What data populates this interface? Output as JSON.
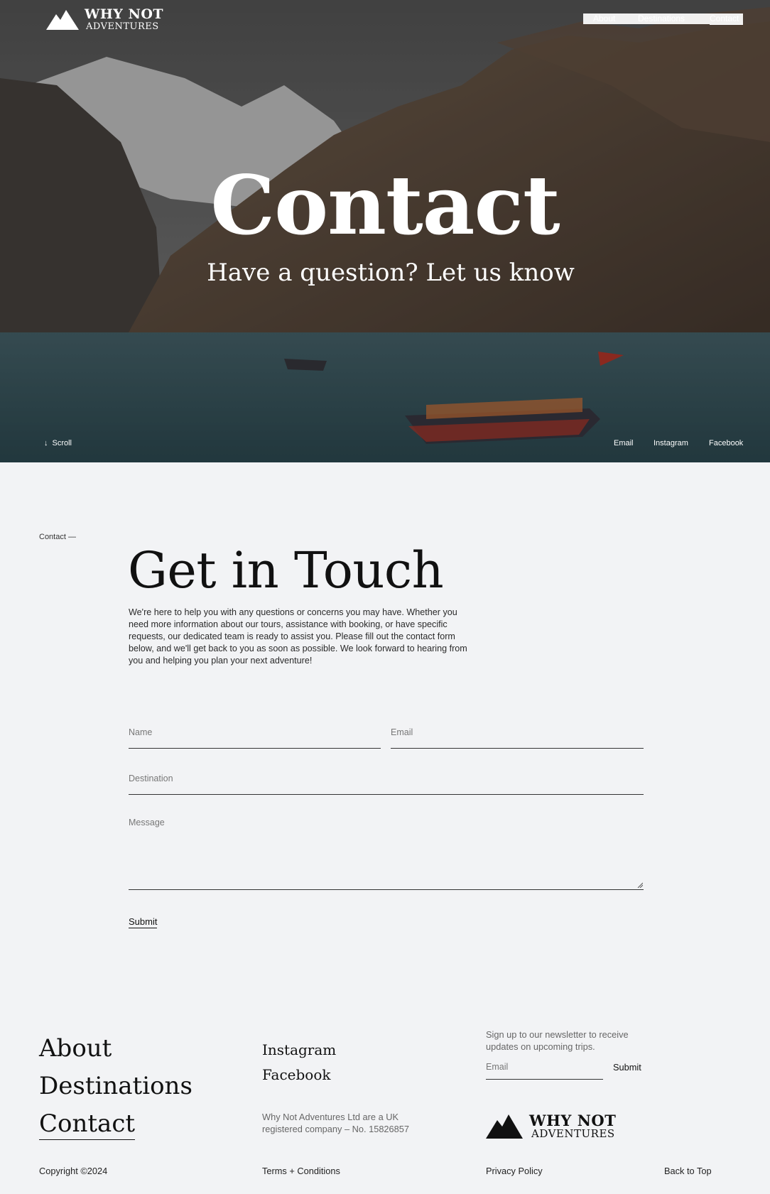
{
  "brand": {
    "line1": "WHY NOT",
    "line2": "ADVENTURES"
  },
  "nav": {
    "about": "About",
    "destinations": "Destinations",
    "contact": "Contact"
  },
  "hero": {
    "title": "Contact",
    "subtitle": "Have a question? Let us know",
    "scroll": "Scroll",
    "social": [
      "Email",
      "Instagram",
      "Facebook"
    ]
  },
  "section": {
    "breadcrumb": "Contact —",
    "heading": "Get in Touch",
    "intro": "We're here to help you with any questions or concerns you may have. Whether you need more information about our tours, assistance with booking, or have specific requests, our dedicated team is ready to assist you. Please fill out the contact form below, and we'll get back to you as soon as possible. We look forward to hearing from you and helping you plan your next adventure!"
  },
  "form": {
    "name_placeholder": "Name",
    "email_placeholder": "Email",
    "destination_placeholder": "Destination",
    "message_placeholder": "Message",
    "submit": "Submit"
  },
  "footer": {
    "nav": [
      "About",
      "Destinations",
      "Contact"
    ],
    "social": [
      "Instagram",
      "Facebook"
    ],
    "company": "Why Not Adventures Ltd are a UK registered company – No. 15826857",
    "newsletter_text": "Sign up to our newsletter to receive updates on upcoming trips.",
    "newsletter_placeholder": "Email",
    "newsletter_submit": "Submit",
    "copyright": "Copyright ©2024",
    "terms": "Terms + Conditions",
    "privacy": "Privacy Policy",
    "back_to_top": "Back to Top"
  },
  "icons": {
    "logo": "mountain-logo-icon",
    "scroll": "arrow-down-icon",
    "resize": "resize-grip-icon"
  },
  "colors": {
    "background": "#f2f3f5",
    "text": "#111111",
    "muted": "#666666",
    "hero_text": "#ffffff",
    "water": "#3f6068"
  }
}
